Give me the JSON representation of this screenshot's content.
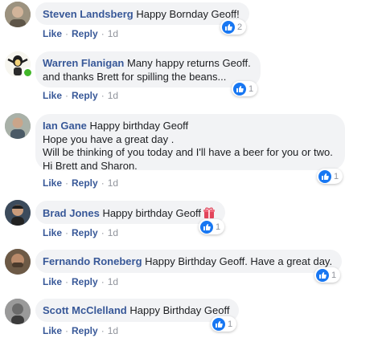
{
  "actions": {
    "like": "Like",
    "reply": "Reply",
    "separator": "·"
  },
  "colors": {
    "author": "#385898",
    "bubble": "#f2f3f5",
    "like_badge": "#1877f2",
    "online": "#42b72a"
  },
  "comments": [
    {
      "author": "Steven Landsberg",
      "lines": [
        "Happy Bornday Geoff!"
      ],
      "time": "1d",
      "reactions": {
        "icon": "like-icon",
        "count": "2"
      }
    },
    {
      "author": "Warren Flanigan",
      "lines": [
        "Many happy returns Geoff.",
        "and thanks Brett for spilling the beans..."
      ],
      "time": "1d",
      "online": true,
      "reactions": {
        "icon": "like-icon",
        "count": "1"
      }
    },
    {
      "author": "Ian Gane",
      "lines": [
        "Happy birthday Geoff",
        "Hope you have a great day .",
        "Will be thinking of you today and I'll have a beer for you or two.",
        "Hi Brett and Sharon."
      ],
      "time": "1d",
      "reactions": {
        "icon": "like-icon",
        "count": "1"
      }
    },
    {
      "author": "Brad Jones",
      "lines": [
        "Happy birthday Geoff"
      ],
      "emoji": "gift-emoji",
      "time": "1d",
      "reactions": {
        "icon": "like-icon",
        "count": "1"
      }
    },
    {
      "author": "Fernando Roneberg",
      "lines": [
        "Happy Birthday Geoff. Have a great day."
      ],
      "time": "1d",
      "reactions": {
        "icon": "like-icon",
        "count": "1"
      }
    },
    {
      "author": "Scott McClelland",
      "lines": [
        "Happy Birthday Geoff"
      ],
      "time": "1d",
      "reactions": {
        "icon": "like-icon",
        "count": "1"
      }
    }
  ]
}
